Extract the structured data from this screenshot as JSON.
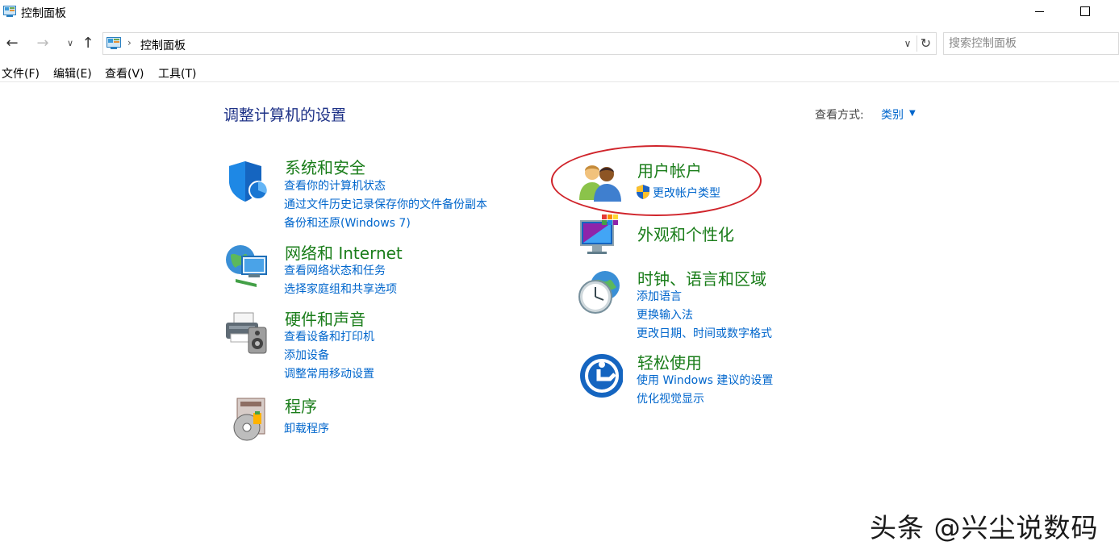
{
  "window": {
    "title": "控制面板"
  },
  "address": {
    "breadcrumb": "控制面板"
  },
  "search": {
    "placeholder": "搜索控制面板"
  },
  "menu": [
    "文件(F)",
    "编辑(E)",
    "查看(V)",
    "工具(T)"
  ],
  "main": {
    "title": "调整计算机的设置",
    "view_by_label": "查看方式:",
    "view_by_value": "类别"
  },
  "categories_left": [
    {
      "title": "系统和安全",
      "icon": "shield-icon",
      "links": [
        "查看你的计算机状态",
        "通过文件历史记录保存你的文件备份副本",
        "备份和还原(Windows 7)"
      ]
    },
    {
      "title": "网络和 Internet",
      "icon": "network-globe-icon",
      "links": [
        "查看网络状态和任务",
        "选择家庭组和共享选项"
      ]
    },
    {
      "title": "硬件和声音",
      "icon": "printer-speaker-icon",
      "links": [
        "查看设备和打印机",
        "添加设备",
        "调整常用移动设置"
      ]
    },
    {
      "title": "程序",
      "icon": "programs-disc-icon",
      "links": [
        "卸载程序"
      ]
    }
  ],
  "categories_right": [
    {
      "title": "用户帐户",
      "icon": "users-icon",
      "links": [
        "更改帐户类型"
      ]
    },
    {
      "title": "外观和个性化",
      "icon": "monitor-palette-icon",
      "links": []
    },
    {
      "title": "时钟、语言和区域",
      "icon": "clock-globe-icon",
      "links": [
        "添加语言",
        "更换输入法",
        "更改日期、时间或数字格式"
      ]
    },
    {
      "title": "轻松使用",
      "icon": "ease-of-access-icon",
      "links": [
        "使用 Windows 建议的设置",
        "优化视觉显示"
      ]
    }
  ],
  "watermark": "头条 @兴尘说数码",
  "colors": {
    "category_title": "#1a7d1a",
    "link": "#0066cc",
    "page_title": "#1e3287",
    "highlight": "#d0242b"
  }
}
